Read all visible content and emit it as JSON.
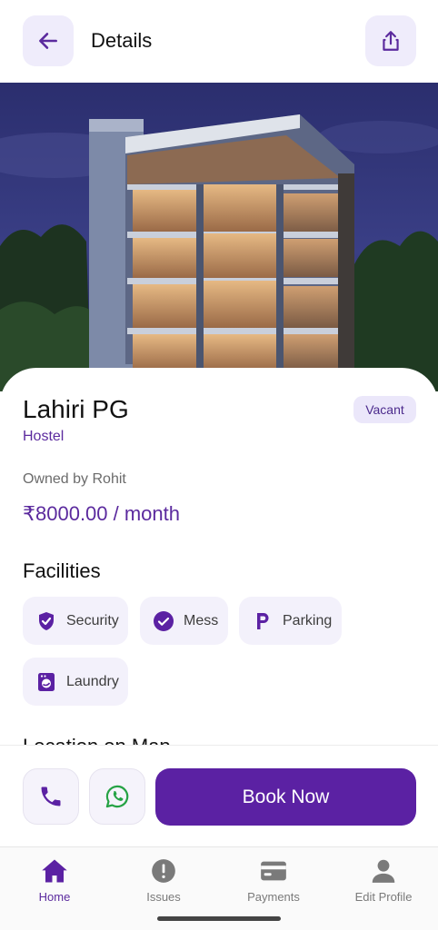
{
  "header": {
    "title": "Details",
    "back_icon": "arrow-left-icon",
    "share_icon": "share-icon"
  },
  "listing": {
    "name": "Lahiri PG",
    "type": "Hostel",
    "status": "Vacant",
    "owner": "Owned by Rohit",
    "price": "₹8000.00 / month"
  },
  "facilities": {
    "title": "Facilities",
    "items": [
      {
        "label": "Security",
        "icon": "shield-check-icon"
      },
      {
        "label": "Mess",
        "icon": "check-circle-icon"
      },
      {
        "label": "Parking",
        "icon": "parking-icon"
      },
      {
        "label": "Laundry",
        "icon": "washing-machine-icon"
      }
    ]
  },
  "location": {
    "title": "Location on Map"
  },
  "actions": {
    "book_label": "Book Now",
    "call_icon": "phone-icon",
    "whatsapp_icon": "whatsapp-icon"
  },
  "nav": {
    "items": [
      {
        "label": "Home",
        "icon": "home-icon",
        "active": true
      },
      {
        "label": "Issues",
        "icon": "alert-circle-icon",
        "active": false
      },
      {
        "label": "Payments",
        "icon": "card-icon",
        "active": false
      },
      {
        "label": "Edit Profile",
        "icon": "person-icon",
        "active": false
      }
    ]
  },
  "colors": {
    "accent": "#5b21a3",
    "accent_text": "#5b2a9e",
    "chip_bg": "#f3f1fb",
    "whatsapp": "#25a244"
  }
}
